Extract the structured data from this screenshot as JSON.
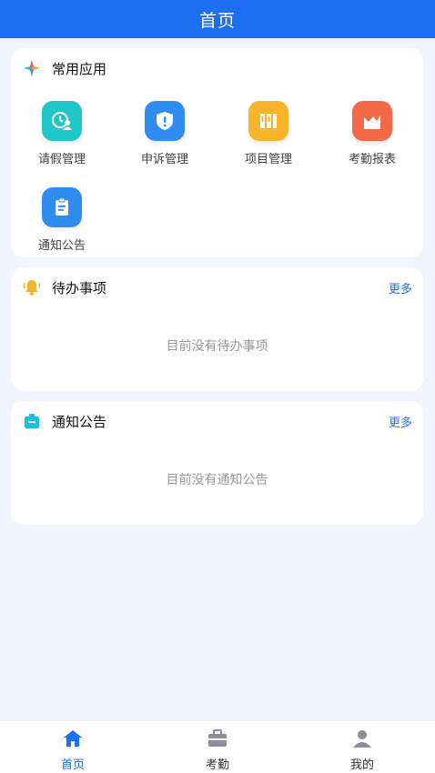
{
  "header": {
    "title": "首页"
  },
  "apps": {
    "title": "常用应用",
    "items": [
      {
        "label": "请假管理",
        "icon": "leave-icon",
        "color": "#20c7c9"
      },
      {
        "label": "申诉管理",
        "icon": "shield-alert-icon",
        "color": "#2f8cf0"
      },
      {
        "label": "项目管理",
        "icon": "books-icon",
        "color": "#f8b42a"
      },
      {
        "label": "考勤报表",
        "icon": "chart-icon",
        "color": "#f36845"
      },
      {
        "label": "通知公告",
        "icon": "clipboard-icon",
        "color": "#2f8cf0"
      }
    ]
  },
  "todo": {
    "title": "待办事项",
    "more": "更多",
    "empty": "目前没有待办事项"
  },
  "notice": {
    "title": "通知公告",
    "more": "更多",
    "empty": "目前没有通知公告"
  },
  "tabbar": {
    "items": [
      {
        "label": "首页",
        "icon": "home-icon",
        "active": true
      },
      {
        "label": "考勤",
        "icon": "briefcase-icon",
        "active": false
      },
      {
        "label": "我的",
        "icon": "user-icon",
        "active": false
      }
    ],
    "active_color": "#1c6ef3"
  }
}
